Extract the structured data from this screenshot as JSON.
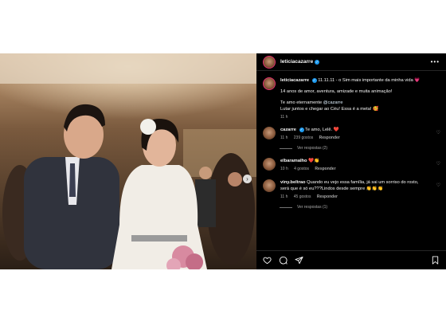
{
  "post": {
    "author": "leticiacazarre",
    "caption": {
      "line1": "11.11.11 - o Sim mais importante da minha vida",
      "line1_emoji": "💗",
      "line2": "14 anos de amor, aventura, amizade e muita animação!",
      "line3a": "Te amo eternamente ",
      "line3_mention": "@cazarre",
      "line4": "Lutar juntos e chegar ao Céu! Essa é a meta!",
      "line4_emoji": "🥰",
      "time": "11 h"
    },
    "comments": [
      {
        "user": "cazarre",
        "verified": true,
        "text": "Te amo, Lelê.",
        "emoji": "❤️",
        "time": "11 h",
        "likes": "239 gostos",
        "reply": "Responder",
        "view_replies": "Ver respostas (2)"
      },
      {
        "user": "elbaramalho",
        "verified": false,
        "text": "",
        "emoji": "❤️👏",
        "time": "10 h",
        "likes": "4 gostos",
        "reply": "Responder"
      },
      {
        "user": "viny.beltrao",
        "verified": false,
        "text": "Quando eu vejo essa família, já sai um sorriso do rosto, será que é só eu???Lindos desde sempre",
        "emoji": "👏👏👏",
        "time": "11 h",
        "likes": "45 gostos",
        "reply": "Responder",
        "view_replies": "Ver respostas (1)"
      }
    ]
  },
  "icons": {
    "like": "heart-icon",
    "comment": "comment-icon",
    "share": "send-icon",
    "save": "bookmark-icon",
    "more": "more-icon",
    "next": "chevron-right-icon"
  },
  "colors": {
    "panel_bg": "#000000",
    "verified": "#1d9bf0",
    "muted": "#a8a8a8"
  }
}
